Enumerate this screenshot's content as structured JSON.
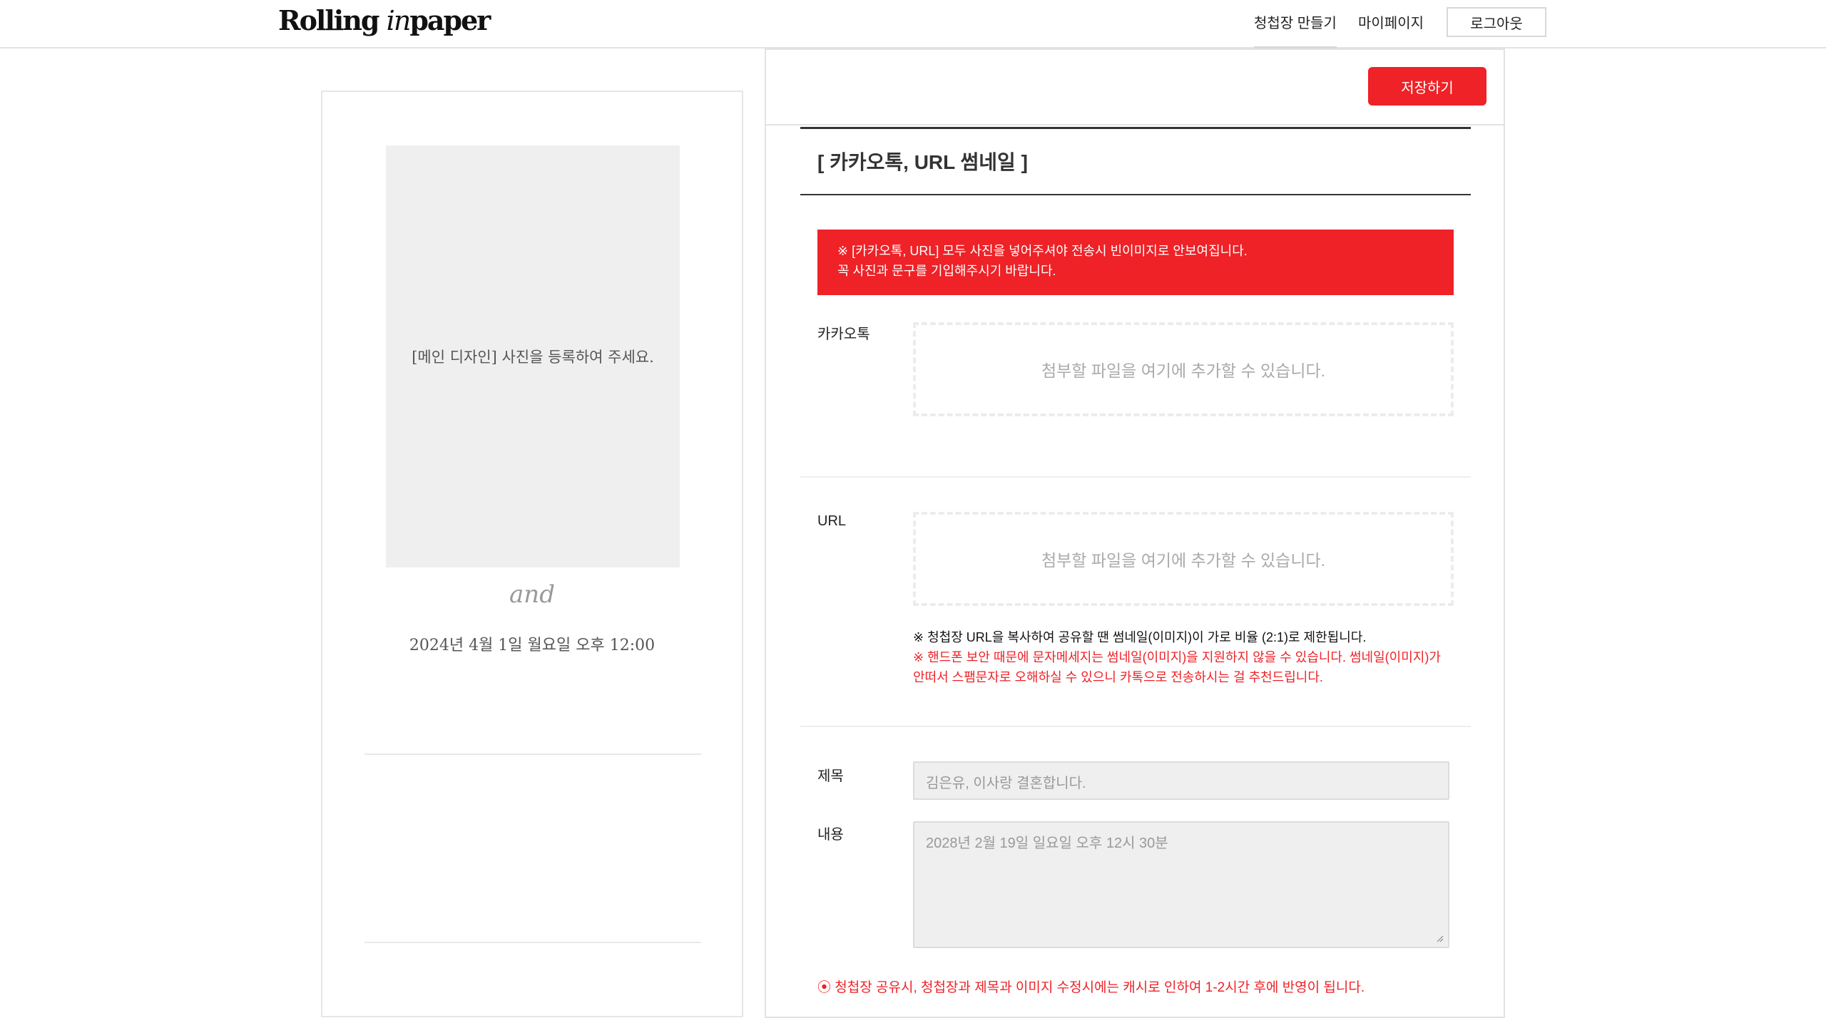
{
  "header": {
    "logo_main": "Rolling ",
    "logo_in": "in",
    "logo_paper": "paper",
    "nav": [
      "청첩장 만들기",
      "마이페이지"
    ],
    "logout": "로그아웃"
  },
  "preview": {
    "photo_placeholder": "[메인 디자인] 사진을 등록하여 주세요.",
    "and": "and",
    "date": "2024년 4월 1일 월요일 오후 12:00"
  },
  "editor": {
    "save": "저장하기",
    "section_title": "[ 카카오톡, URL 썸네일 ]",
    "notice_line1": "※ [카카오톡, URL] 모두 사진을 넣어주셔야 전송시 빈이미지로 안보여집니다.",
    "notice_line2": "꼭 사진과 문구를 기입해주시기 바랍니다.",
    "kakao_label": "카카오톡",
    "kakao_dropzone": "첨부할 파일을 여기에 추가할 수 있습니다.",
    "url_label": "URL",
    "url_dropzone": "첨부할 파일을 여기에 추가할 수 있습니다.",
    "url_note_black": "※ 청첩장 URL을 복사하여 공유할 땐 썸네일(이미지)이 가로 비율 (2:1)로 제한됩니다.",
    "url_note_red_1": "※ 핸드폰 보안 때문에 문자메세지는 썸네일(이미지)을 지원하지 않을 수 있습니다. 썸네일(이미지)가",
    "url_note_red_2": "안떠서 스팸문자로 오해하실 수 있으니 카톡으로 전송하시는 걸 추천드립니다.",
    "title_label": "제목",
    "title_placeholder": "김은유, 이사랑 결혼합니다.",
    "content_label": "내용",
    "content_placeholder": "2028년 2월 19일 일요일 오후 12시 30분",
    "bottom_notice": "⦿ 청첩장 공유시, 청첩장과 제목과 이미지 수정시에는 캐시로 인하여 1-2시간 후에 반영이 됩니다."
  },
  "colors": {
    "accent": "#ee2227",
    "placeholder_bg": "#efefef"
  }
}
